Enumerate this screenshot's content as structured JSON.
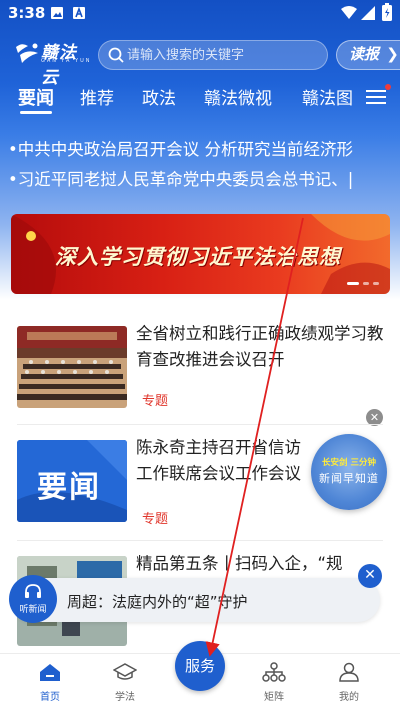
{
  "status": {
    "time": "3:38"
  },
  "app": {
    "logo_text": "赣法云",
    "logo_sub": "GAN FA YUN"
  },
  "search": {
    "placeholder": "请输入搜索的关键字",
    "value": ""
  },
  "header": {
    "read_button": "读报"
  },
  "tabs": [
    "要闻",
    "推荐",
    "政法",
    "赣法微视",
    "赣法图"
  ],
  "ticker": [
    "•中共中央政治局召开会议 分析研究当前经济形",
    "•习近平同老挝人民革命党中央委员会总书记、|"
  ],
  "banner": {
    "text": "深入学习贯彻习近平法治思想"
  },
  "news": [
    {
      "title": "全省树立和践行正确政绩观学习教育查改推进会议召开",
      "tag": "专题"
    },
    {
      "title": "陈永奇主持召开省信访工作联席会议工作会议",
      "tag": "专题",
      "thumb_text": "要闻"
    },
    {
      "title": "精品第五条丨扫码入企，“规行”有行政执法数字“系统”",
      "tag": ""
    }
  ],
  "float_badge": {
    "top": "长安剑 三分钟",
    "bottom": "新闻早知道"
  },
  "audio": {
    "label": "听新闻",
    "title": "周超：法庭内外的“超”守护"
  },
  "nav": [
    {
      "label": "首页",
      "icon": "home-icon"
    },
    {
      "label": "学法",
      "icon": "graduation-cap-icon"
    },
    {
      "label": "服务",
      "icon": ""
    },
    {
      "label": "矩阵",
      "icon": "network-icon"
    },
    {
      "label": "我的",
      "icon": "person-icon"
    }
  ],
  "colors": {
    "brand_blue": "#1f5fce",
    "tag_red": "#e0352b",
    "banner_red": "#d82014"
  }
}
